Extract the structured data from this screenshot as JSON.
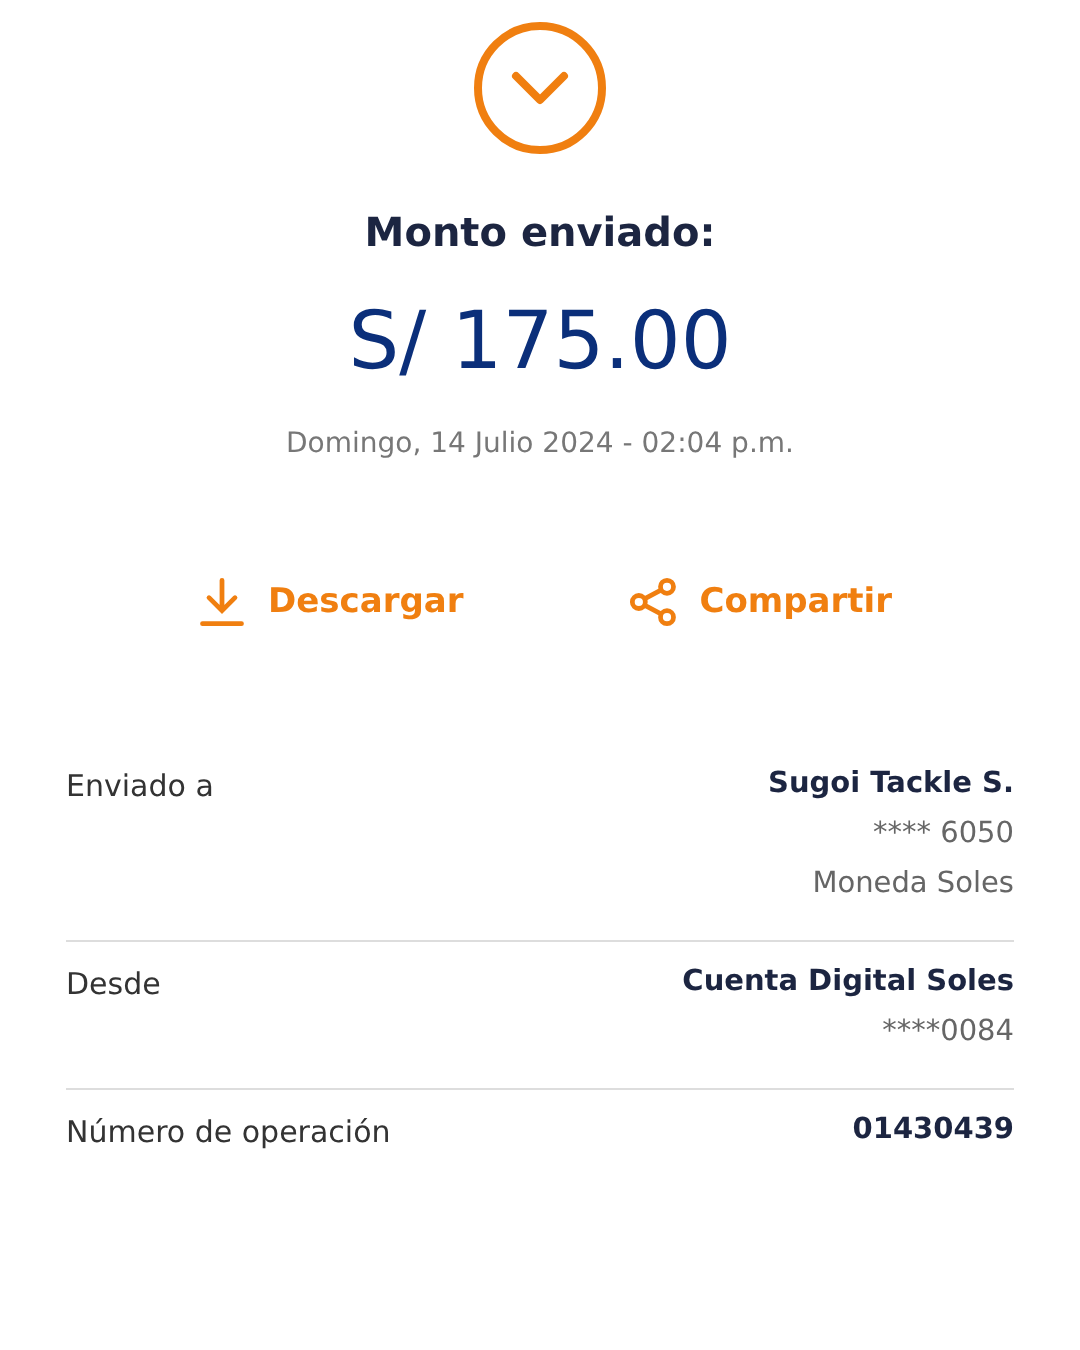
{
  "header": {
    "title": "Monto enviado:",
    "amount": "S/ 175.00",
    "date": "Domingo, 14 Julio 2024 - 02:04 p.m."
  },
  "actions": [
    {
      "kind": "download",
      "label": "Descargar"
    },
    {
      "kind": "share",
      "label": "Compartir"
    }
  ],
  "details": [
    {
      "label": "Enviado a",
      "values": [
        "Sugoi Tackle S.",
        "**** 6050",
        "Moneda Soles"
      ]
    },
    {
      "label": "Desde",
      "values": [
        "Cuenta Digital Soles",
        "****0084"
      ]
    },
    {
      "label": "Número de operación",
      "values": [
        "01430439"
      ]
    }
  ]
}
